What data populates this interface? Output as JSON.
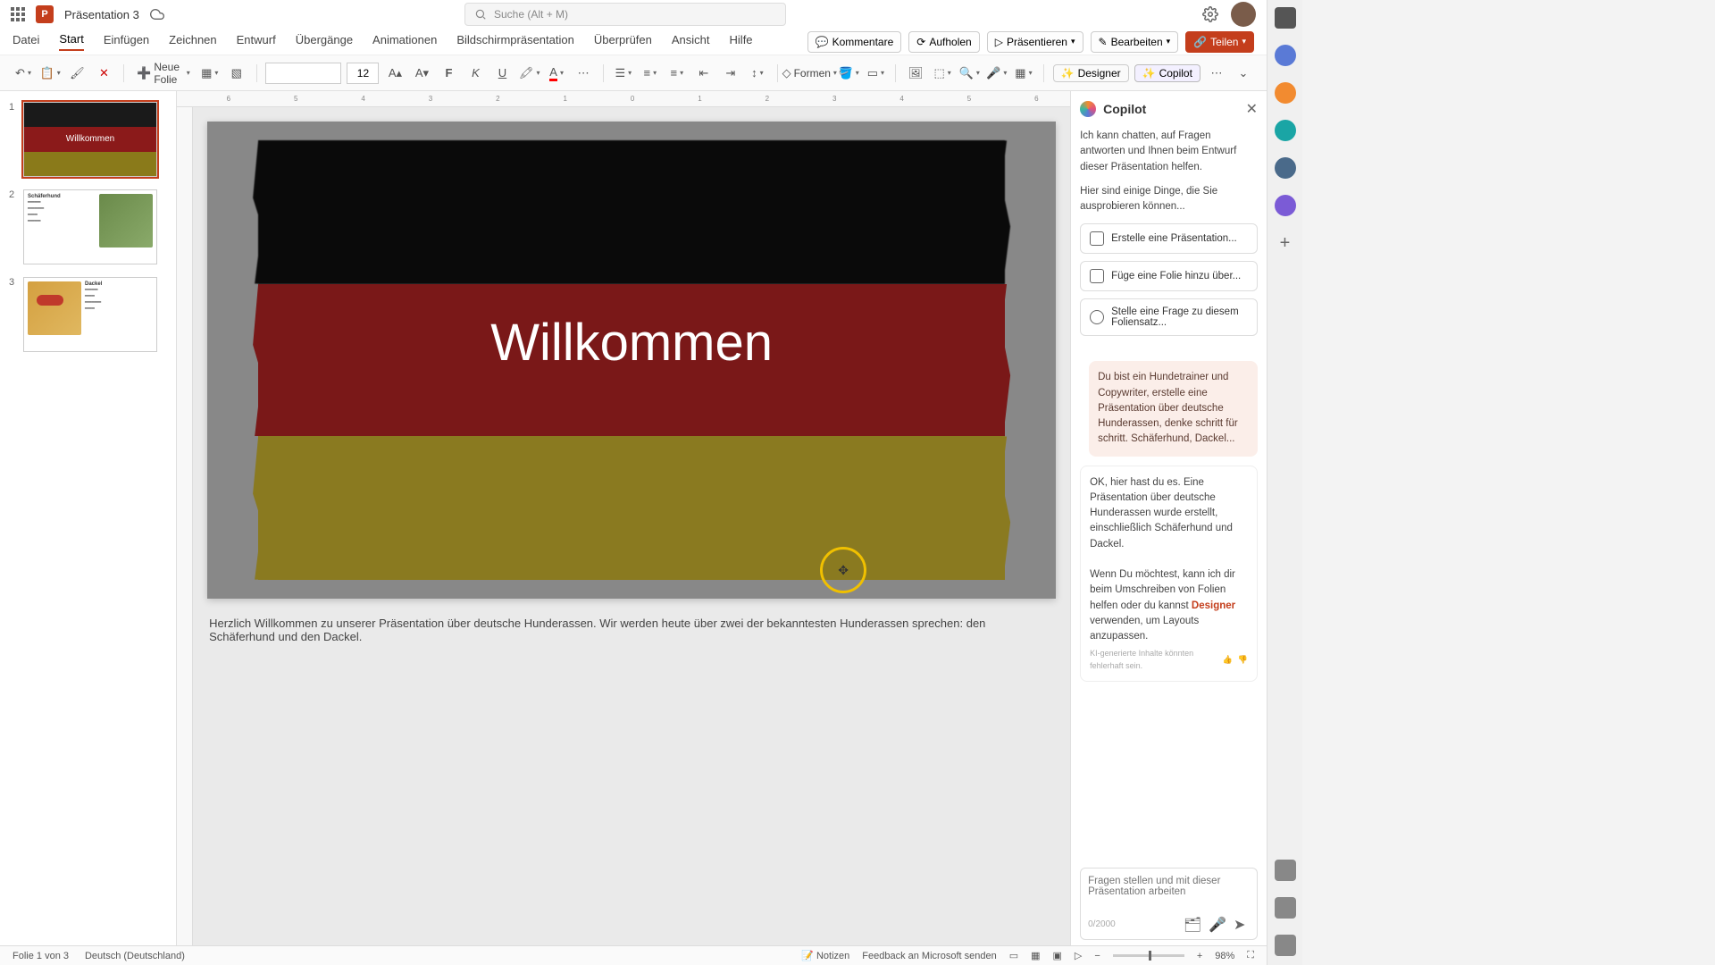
{
  "titlebar": {
    "doc_title": "Präsentation 3",
    "search_placeholder": "Suche (Alt + M)"
  },
  "menus": {
    "datei": "Datei",
    "start": "Start",
    "einfuegen": "Einfügen",
    "zeichnen": "Zeichnen",
    "entwurf": "Entwurf",
    "uebergaenge": "Übergänge",
    "animationen": "Animationen",
    "bildschirm": "Bildschirmpräsentation",
    "ueberpruefen": "Überprüfen",
    "ansicht": "Ansicht",
    "hilfe": "Hilfe",
    "kommentare": "Kommentare",
    "aufholen": "Aufholen",
    "praesentieren": "Präsentieren",
    "bearbeiten": "Bearbeiten",
    "teilen": "Teilen"
  },
  "toolbar": {
    "neue_folie": "Neue Folie",
    "font_size": "12",
    "formen": "Formen",
    "designer": "Designer",
    "copilot": "Copilot"
  },
  "slides": {
    "s1_num": "1",
    "s1_title": "Willkommen",
    "s2_num": "2",
    "s2_title": "Schäferhund",
    "s3_num": "3",
    "s3_title": "Dackel"
  },
  "main_slide": {
    "title": "Willkommen"
  },
  "notes": {
    "text": "Herzlich Willkommen zu unserer Präsentation über deutsche Hunderassen. Wir werden heute über zwei der bekanntesten Hunderassen sprechen: den Schäferhund und den Dackel."
  },
  "copilot": {
    "title": "Copilot",
    "intro1": "Ich kann chatten, auf Fragen antworten und Ihnen beim Entwurf dieser Präsentation helfen.",
    "intro2": "Hier sind einige Dinge, die Sie ausprobieren können...",
    "sug1": "Erstelle eine Präsentation...",
    "sug2": "Füge eine Folie hinzu über...",
    "sug3": "Stelle eine Frage zu diesem Foliensatz...",
    "user_msg": "Du bist ein Hundetrainer und Copywriter, erstelle eine Präsentation über deutsche Hunderassen, denke schritt für schritt. Schäferhund, Dackel...",
    "bot_msg1": "OK, hier hast du es. Eine Präsentation über deutsche Hunderassen wurde erstellt, einschließlich Schäferhund und Dackel.",
    "bot_msg2a": "Wenn Du möchtest, kann ich dir beim Umschreiben von Folien helfen oder du kannst ",
    "bot_msg2_link": "Designer",
    "bot_msg2b": " verwenden, um Layouts anzupassen.",
    "disclaimer": "KI-generierte Inhalte könnten fehlerhaft sein.",
    "input_placeholder": "Fragen stellen und mit dieser Präsentation arbeiten",
    "counter": "0/2000"
  },
  "status": {
    "slide_info": "Folie 1 von 3",
    "language": "Deutsch (Deutschland)",
    "notizen": "Notizen",
    "feedback": "Feedback an Microsoft senden",
    "zoom": "98%"
  },
  "ruler": [
    "6",
    "5",
    "4",
    "3",
    "2",
    "1",
    "0",
    "1",
    "2",
    "3",
    "4",
    "5",
    "6"
  ]
}
